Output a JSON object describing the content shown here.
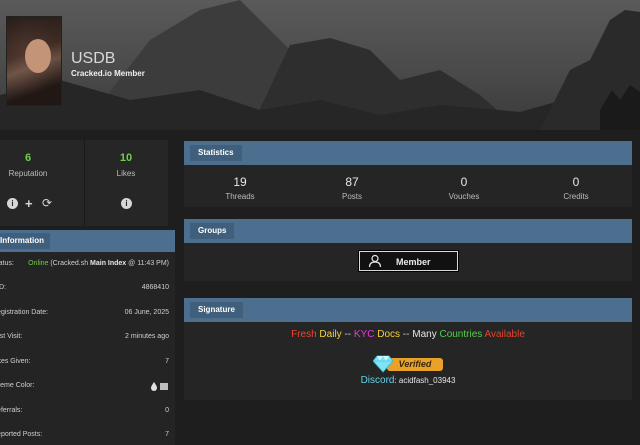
{
  "profile": {
    "username": "USDB",
    "usertitle": "Cracked.io Member"
  },
  "left_stats": [
    {
      "value": "6",
      "label": "Reputation"
    },
    {
      "value": "10",
      "label": "Likes"
    }
  ],
  "icons": {
    "info_a": "info-icon",
    "add": "plus-icon",
    "refresh": "refresh-icon",
    "info_b": "info-icon"
  },
  "information": {
    "header": "Information",
    "rows": [
      {
        "key": "Status:",
        "value_parts": {
          "status": "Online",
          "pre": " (Cracked.sh ",
          "page": "Main Index",
          "post": " @ 11:43 PM)"
        }
      },
      {
        "key": "UID:",
        "value": "4868410"
      },
      {
        "key": "Registration Date:",
        "value": "06 June, 2025"
      },
      {
        "key": "Last Visit:",
        "value": "2 minutes ago"
      },
      {
        "key": "Likes Given:",
        "value": "7"
      },
      {
        "key": "Theme Color:",
        "value": ""
      },
      {
        "key": "Referrals:",
        "value": "0"
      },
      {
        "key": "Reported Posts:",
        "value": "7"
      }
    ]
  },
  "statistics": {
    "header": "Statistics",
    "items": [
      {
        "value": "19",
        "label": "Threads"
      },
      {
        "value": "87",
        "label": "Posts"
      },
      {
        "value": "0",
        "label": "Vouches"
      },
      {
        "value": "0",
        "label": "Credits"
      }
    ]
  },
  "groups": {
    "header": "Groups",
    "badge": "Member"
  },
  "signature": {
    "header": "Signature",
    "line": [
      {
        "text": "Fresh",
        "color": "#f0432e"
      },
      {
        "text": " Daily",
        "color": "#f2d23a"
      },
      {
        "text": " -- ",
        "color": "#cfcfcf"
      },
      {
        "text": "KYC",
        "color": "#e83ad8"
      },
      {
        "text": " Docs",
        "color": "#f2d23a"
      },
      {
        "text": " -- ",
        "color": "#cfcfcf"
      },
      {
        "text": "Many",
        "color": "#e6e6e6"
      },
      {
        "text": " Countries",
        "color": "#4fd04a"
      },
      {
        "text": " Available",
        "color": "#e0452d"
      }
    ],
    "verified": "Verified",
    "discord_label": "Discord",
    "discord_handle": "acidfash_03943"
  },
  "colors": {
    "panel_header": "#4c6f8f",
    "accent_green": "#6fcf4a"
  }
}
